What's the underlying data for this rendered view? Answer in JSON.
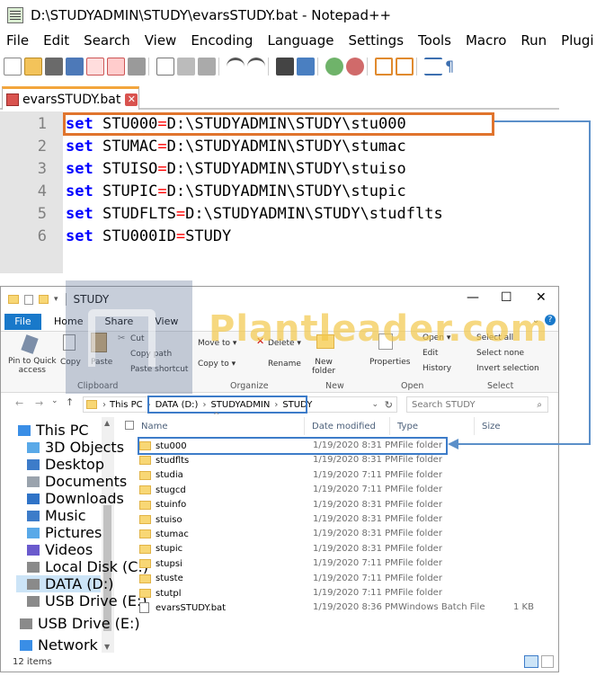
{
  "notepad": {
    "title": "D:\\STUDYADMIN\\STUDY\\evarsSTUDY.bat - Notepad++",
    "menu": [
      "File",
      "Edit",
      "Search",
      "View",
      "Encoding",
      "Language",
      "Settings",
      "Tools",
      "Macro",
      "Run",
      "Plugi"
    ],
    "tab_name": "evarsSTUDY.bat",
    "tab_close": "✕",
    "lines": [
      {
        "num": "1",
        "kw": "set",
        "name": "STU000",
        "eq": "=",
        "val": "D:\\STUDYADMIN\\STUDY\\stu000"
      },
      {
        "num": "2",
        "kw": "set",
        "name": "STUMAC",
        "eq": "=",
        "val": "D:\\STUDYADMIN\\STUDY\\stumac"
      },
      {
        "num": "3",
        "kw": "set",
        "name": "STUISO",
        "eq": "=",
        "val": "D:\\STUDYADMIN\\STUDY\\stuiso"
      },
      {
        "num": "4",
        "kw": "set",
        "name": "STUPIC",
        "eq": "=",
        "val": "D:\\STUDYADMIN\\STUDY\\stupic"
      },
      {
        "num": "5",
        "kw": "set",
        "name": "STUDFLTS",
        "eq": "=",
        "val": "D:\\STUDYADMIN\\STUDY\\studflts"
      },
      {
        "num": "6",
        "kw": "set",
        "name": "STU000ID",
        "eq": "=",
        "val": "STUDY"
      }
    ]
  },
  "explorer": {
    "title": "STUDY",
    "window_controls": {
      "min": "—",
      "max": "☐",
      "close": "✕"
    },
    "ribbon_tabs": {
      "file": "File",
      "home": "Home",
      "share": "Share",
      "view": "View"
    },
    "ribbon": {
      "pin": "Pin to Quick\naccess",
      "copy": "Copy",
      "paste": "Paste",
      "cut": "Cut",
      "copy_path": "Copy path",
      "paste_shortcut": "Paste shortcut",
      "move_to": "Move to ▾",
      "delete": "Delete ▾",
      "copy_to": "Copy to ▾",
      "rename": "Rename",
      "new_folder": "New\nfolder",
      "properties": "Properties",
      "open": "Open ▾",
      "edit": "Edit",
      "history": "History",
      "select_all": "Select all",
      "select_none": "Select none",
      "invert_selection": "Invert selection",
      "groups": {
        "clipboard": "Clipboard",
        "organize": "Organize",
        "new": "New",
        "open": "Open",
        "select": "Select"
      }
    },
    "address": {
      "this_pc": "This PC",
      "drive": "DATA (D:)",
      "folder1": "STUDYADMIN",
      "folder2": "STUDY"
    },
    "search_placeholder": "Search STUDY",
    "nav": [
      {
        "label": "This PC"
      },
      {
        "label": "3D Objects"
      },
      {
        "label": "Desktop"
      },
      {
        "label": "Documents"
      },
      {
        "label": "Downloads"
      },
      {
        "label": "Music"
      },
      {
        "label": "Pictures"
      },
      {
        "label": "Videos"
      },
      {
        "label": "Local Disk (C:)"
      },
      {
        "label": "DATA (D:)"
      },
      {
        "label": "USB Drive (E:)"
      },
      {
        "label": "USB Drive (E:)"
      },
      {
        "label": "Network"
      }
    ],
    "columns": {
      "name": "Name",
      "date": "Date modified",
      "type": "Type",
      "size": "Size"
    },
    "files": [
      {
        "name": "stu000",
        "date": "1/19/2020 8:31 PM",
        "type": "File folder",
        "size": ""
      },
      {
        "name": "studflts",
        "date": "1/19/2020 8:31 PM",
        "type": "File folder",
        "size": ""
      },
      {
        "name": "studia",
        "date": "1/19/2020 7:11 PM",
        "type": "File folder",
        "size": ""
      },
      {
        "name": "stugcd",
        "date": "1/19/2020 7:11 PM",
        "type": "File folder",
        "size": ""
      },
      {
        "name": "stuinfo",
        "date": "1/19/2020 8:31 PM",
        "type": "File folder",
        "size": ""
      },
      {
        "name": "stuiso",
        "date": "1/19/2020 8:31 PM",
        "type": "File folder",
        "size": ""
      },
      {
        "name": "stumac",
        "date": "1/19/2020 8:31 PM",
        "type": "File folder",
        "size": ""
      },
      {
        "name": "stupic",
        "date": "1/19/2020 8:31 PM",
        "type": "File folder",
        "size": ""
      },
      {
        "name": "stupsi",
        "date": "1/19/2020 7:11 PM",
        "type": "File folder",
        "size": ""
      },
      {
        "name": "stuste",
        "date": "1/19/2020 7:11 PM",
        "type": "File folder",
        "size": ""
      },
      {
        "name": "stutpl",
        "date": "1/19/2020 7:11 PM",
        "type": "File folder",
        "size": ""
      },
      {
        "name": "evarsSTUDY.bat",
        "date": "1/19/2020 8:36 PM",
        "type": "Windows Batch File",
        "size": "1 KB"
      }
    ],
    "status": "12 items"
  },
  "watermark": "Plantleader.com",
  "colors": {
    "highlight_orange": "#e0742d",
    "highlight_blue": "#3d7cc9",
    "keyword_blue": "#0000ff",
    "operator_red": "#ff0000",
    "folder_yellow": "#f8d775"
  }
}
